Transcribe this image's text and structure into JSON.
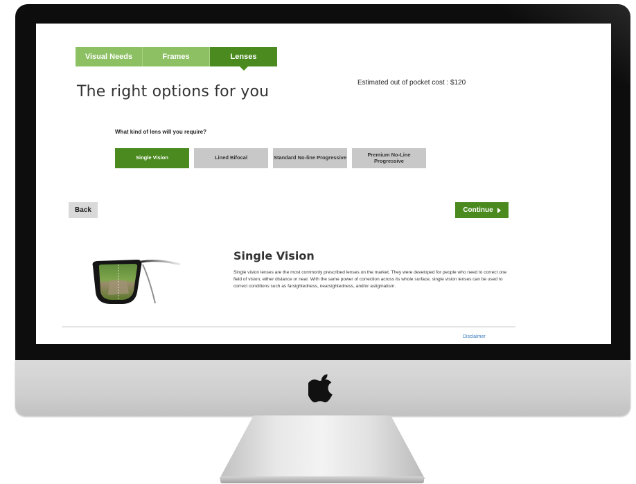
{
  "steps": [
    {
      "label": "Visual Needs",
      "active": false
    },
    {
      "label": "Frames",
      "active": false
    },
    {
      "label": "Lenses",
      "active": true
    }
  ],
  "page_title": "The right options for you",
  "cost_label": "Estimated out of pocket cost : $120",
  "question": "What kind of lens will you require?",
  "lens_options": [
    {
      "label": "Single Vision",
      "selected": true
    },
    {
      "label": "Lined Bifocal",
      "selected": false
    },
    {
      "label": "Standard No-line Progressive",
      "selected": false
    },
    {
      "label": "Premium No-Line Progressive",
      "selected": false
    }
  ],
  "nav": {
    "back_label": "Back",
    "continue_label": "Continue"
  },
  "info": {
    "title": "Single Vision",
    "text": "Single vision lenses are the most commonly prescribed lenses on the market. They were developed for people who need to correct one field of vision, either distance or near. With the same power of correction across its whole surface, single vision lenses can be used to correct conditions such as farsightedness, nearsightedness, and/or astigmatism."
  },
  "footer": {
    "disclaimer_label": "Disclaimer"
  },
  "colors": {
    "accent_green": "#4a8a1e",
    "light_green": "#8cc063",
    "option_gray": "#c8c8c8",
    "link_blue": "#3a7bbf"
  },
  "icons": {
    "device_logo": "apple-logo-icon",
    "continue_arrow": "arrow-right-icon"
  }
}
